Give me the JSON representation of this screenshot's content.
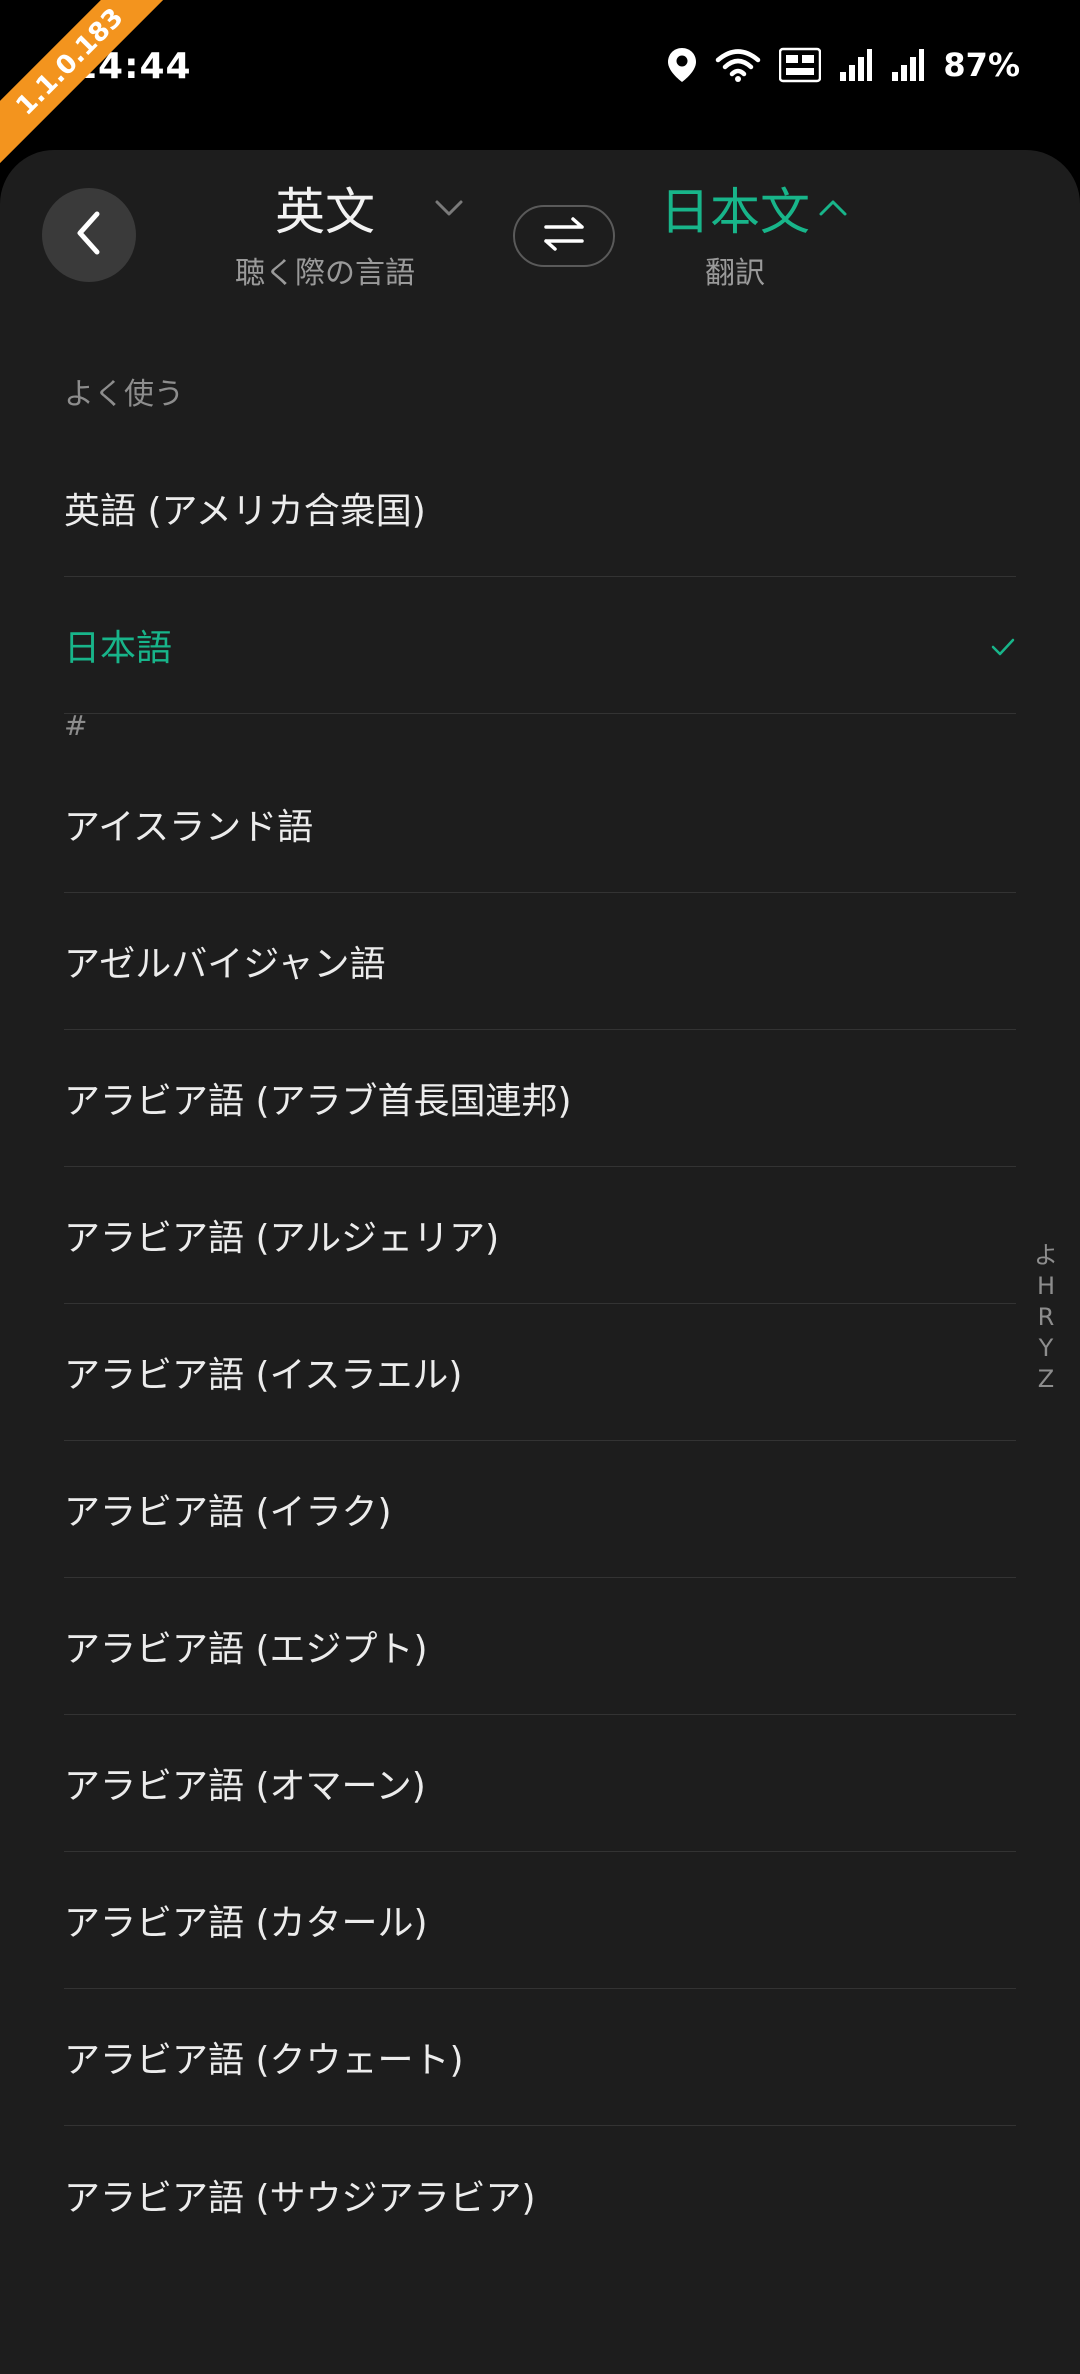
{
  "status_bar": {
    "time": "14:44",
    "battery": "87%",
    "version_badge": "1.1.0.183",
    "icons": [
      "location-icon",
      "wifi-icon",
      "volte-icon",
      "signal-icon",
      "signal-icon"
    ]
  },
  "header": {
    "source_language": "英文",
    "source_caption": "聴く際の言語",
    "target_language": "日本文",
    "target_caption": "翻訳"
  },
  "sections": {
    "frequent": "よく使う",
    "hash": "#"
  },
  "frequent_languages": [
    {
      "label": "英語 (アメリカ合衆国)",
      "selected": false
    },
    {
      "label": "日本語",
      "selected": true
    }
  ],
  "all_languages": [
    "アイスランド語",
    "アゼルバイジャン語",
    "アラビア語 (アラブ首長国連邦)",
    "アラビア語 (アルジェリア)",
    "アラビア語 (イスラエル)",
    "アラビア語 (イラク)",
    "アラビア語 (エジプト)",
    "アラビア語 (オマーン)",
    "アラビア語 (カタール)",
    "アラビア語 (クウェート)",
    "アラビア語 (サウジアラビア)"
  ],
  "index_letters": [
    "よ",
    "H",
    "R",
    "Y",
    "Z"
  ],
  "colors": {
    "accent": "#18b58a",
    "background": "#1d1d1d",
    "badge": "#f3941e"
  }
}
